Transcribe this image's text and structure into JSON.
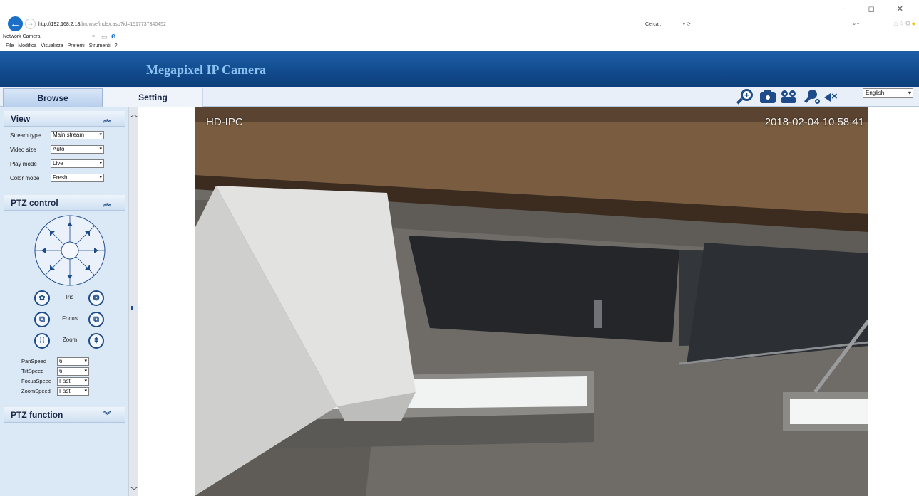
{
  "browser": {
    "url_host": "http://192.168.2.18",
    "url_path": "/browse/index.asp?id=1517737340452",
    "refresh": "▾ ⟳",
    "search_placeholder": "Cerca...",
    "search_icon": "⌕ ▾",
    "window_controls": "− ◻ ✕",
    "tab_title": "Network Camera",
    "tab_close": "×",
    "menu": [
      "File",
      "Modifica",
      "Visualizza",
      "Preferiti",
      "Strumenti",
      "?"
    ]
  },
  "app": {
    "title": "Megapixel IP Camera",
    "tabs": [
      "Browse",
      "Setting"
    ],
    "language": "English"
  },
  "view": {
    "header": "View",
    "rows": [
      {
        "label": "Stream type",
        "value": "Main stream"
      },
      {
        "label": "Video size",
        "value": "Auto"
      },
      {
        "label": "Play mode",
        "value": "Live"
      },
      {
        "label": "Color mode",
        "value": "Fresh"
      }
    ]
  },
  "ptz": {
    "header": "PTZ control",
    "iris_label": "Iris",
    "focus_label": "Focus",
    "zoom_label": "Zoom",
    "speeds": [
      {
        "label": "PanSpeed",
        "value": "6"
      },
      {
        "label": "TiltSpeed",
        "value": "6"
      },
      {
        "label": "FocusSpeed",
        "value": "Fast"
      },
      {
        "label": "ZoomSpeed",
        "value": "Fast"
      }
    ]
  },
  "ptz_function": {
    "header": "PTZ function"
  },
  "video": {
    "osd_name": "HD-IPC",
    "osd_time": "2018-02-04  10:58:41"
  },
  "icons": {
    "accent": "#1e4c8a",
    "banner": "#1d5ea7",
    "toolbar": [
      "zoom-in-icon",
      "snapshot-camera-icon",
      "record-icon",
      "talk-microphone-icon",
      "mute-speaker-icon"
    ]
  }
}
